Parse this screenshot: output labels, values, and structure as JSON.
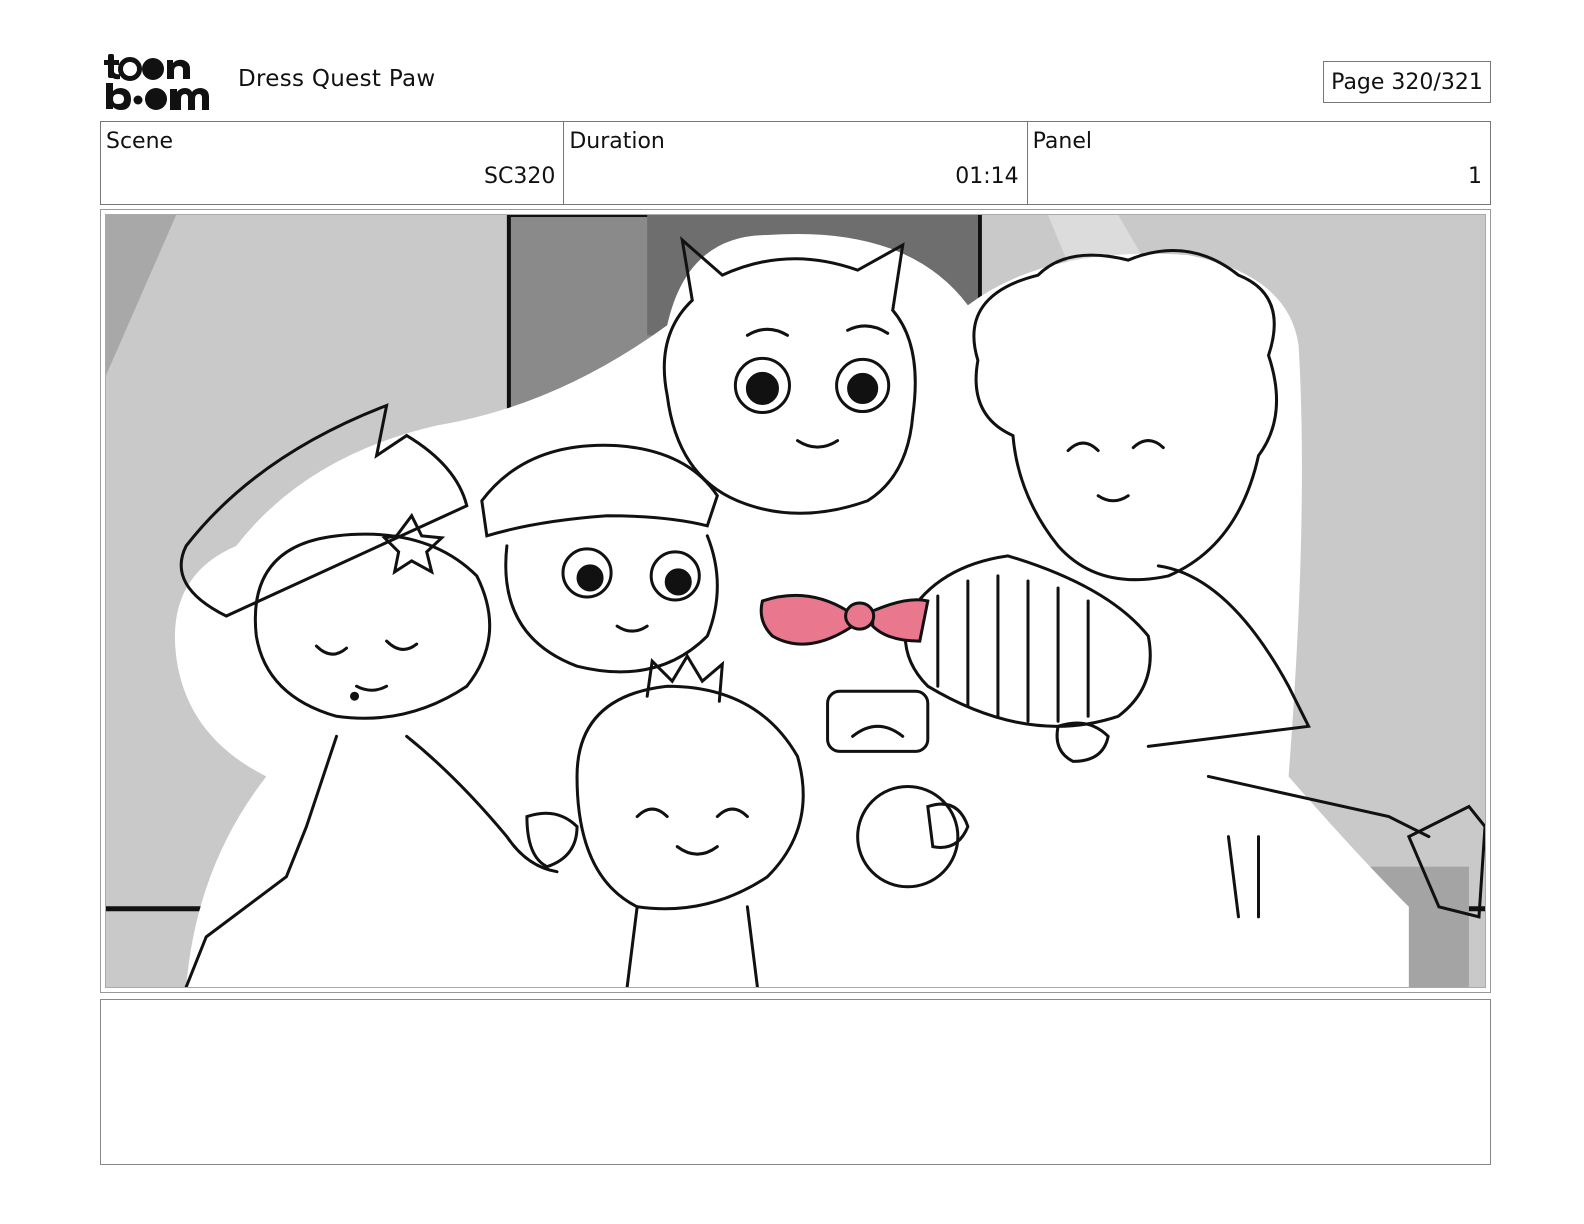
{
  "header": {
    "logo_text": "toon boom",
    "project_title": "Dress Quest Paw",
    "page_label": "Page 320/321"
  },
  "info": {
    "scene_label": "Scene",
    "scene_value": "SC320",
    "duration_label": "Duration",
    "duration_value": "01:14",
    "panel_label": "Panel",
    "panel_value": "1"
  },
  "panel_image": {
    "accent_colors": {
      "ribbon": "#e9788e",
      "background": "#c9c9c9",
      "dark_wall": "#8a8a8a"
    }
  },
  "notes": {
    "text": ""
  }
}
